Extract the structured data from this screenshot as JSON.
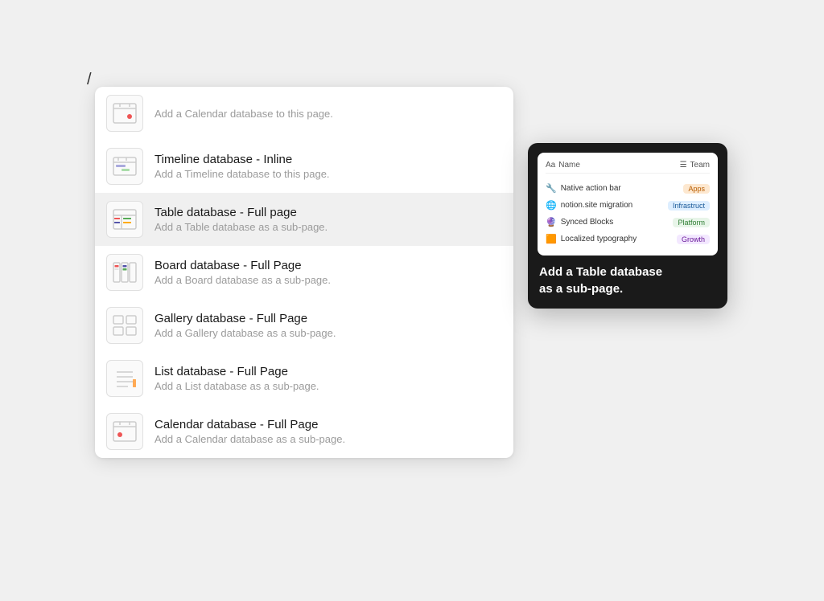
{
  "cursor": "/",
  "dropdown": {
    "items": [
      {
        "id": "calendar-inline",
        "title": "",
        "desc": "Add a Calendar database to this page.",
        "icon_type": "calendar-inline"
      },
      {
        "id": "timeline-inline",
        "title": "Timeline database - Inline",
        "desc": "Add a Timeline database to this page.",
        "icon_type": "timeline-inline"
      },
      {
        "id": "table-fullpage",
        "title": "Table database - Full page",
        "desc": "Add a Table database as a sub-page.",
        "icon_type": "table-full",
        "active": true
      },
      {
        "id": "board-fullpage",
        "title": "Board database - Full Page",
        "desc": "Add a Board database as a sub-page.",
        "icon_type": "board-full"
      },
      {
        "id": "gallery-fullpage",
        "title": "Gallery database - Full Page",
        "desc": "Add a Gallery database as a sub-page.",
        "icon_type": "gallery-full"
      },
      {
        "id": "list-fullpage",
        "title": "List database - Full Page",
        "desc": "Add a List database as a sub-page.",
        "icon_type": "list-full"
      },
      {
        "id": "calendar-fullpage",
        "title": "Calendar database - Full Page",
        "desc": "Add a Calendar database as a sub-page.",
        "icon_type": "calendar-full"
      }
    ]
  },
  "tooltip": {
    "preview": {
      "col_name": "Name",
      "col_team": "Team",
      "rows": [
        {
          "emoji": "🔧",
          "name": "Native action bar",
          "badge": "Apps",
          "badge_class": "badge-apps"
        },
        {
          "emoji": "🌐",
          "name": "notion.site migration",
          "badge": "Infrastruct",
          "badge_class": "badge-infra"
        },
        {
          "emoji": "🔮",
          "name": "Synced Blocks",
          "badge": "Platform",
          "badge_class": "badge-platform"
        },
        {
          "emoji": "🟧",
          "name": "Localized typography",
          "badge": "Growth",
          "badge_class": "badge-growth"
        }
      ]
    },
    "text_line1": "Add a Table database",
    "text_line2": "as a sub-page."
  }
}
